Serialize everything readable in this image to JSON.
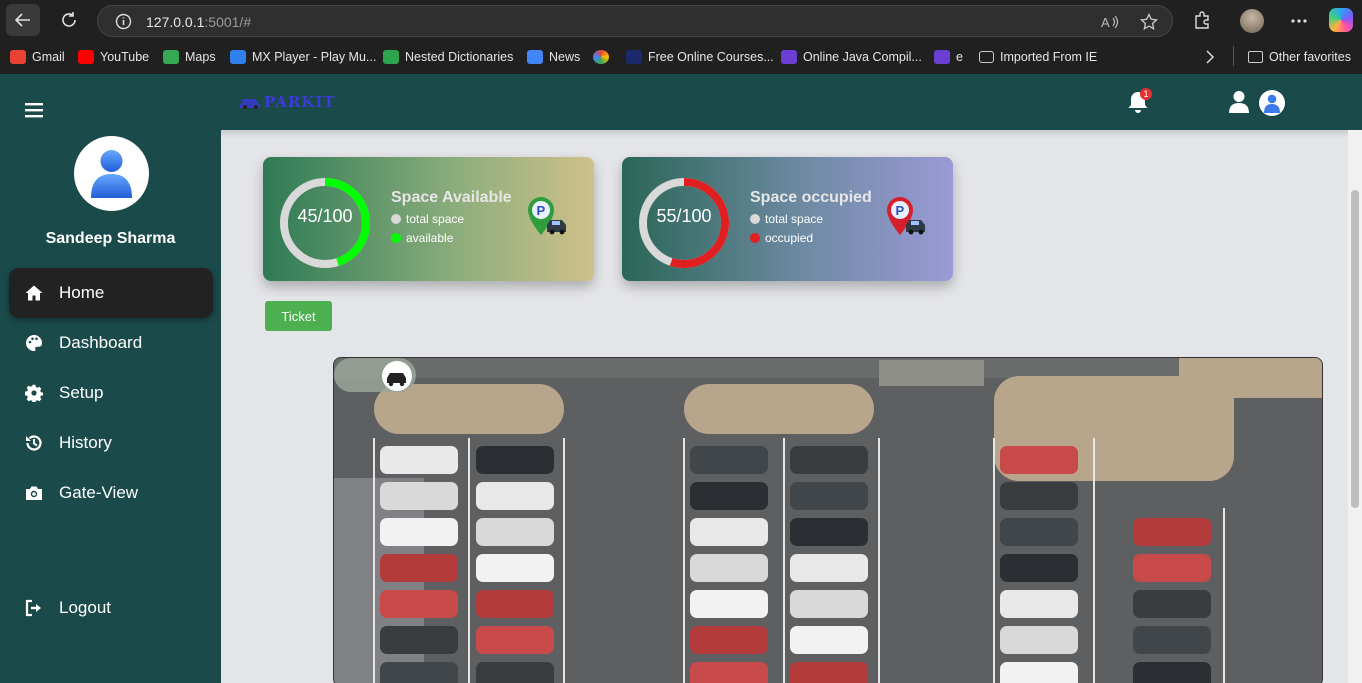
{
  "browser": {
    "url_host": "127.0.0.1",
    "url_rest": ":5001/#",
    "bookmarks": [
      {
        "label": "Gmail",
        "color": "#ea4335"
      },
      {
        "label": "YouTube",
        "color": "#ff0000"
      },
      {
        "label": "Maps",
        "color": "#34a853"
      },
      {
        "label": "MX Player - Play Mu...",
        "color": "#2f80ed"
      },
      {
        "label": "Nested Dictionaries",
        "color": "#2ea44f"
      },
      {
        "label": "News",
        "color": "#4285f4"
      },
      {
        "label": "",
        "color": "#ffffff"
      },
      {
        "label": "Free Online Courses...",
        "color": "#1a2a6c"
      },
      {
        "label": "Online Java Compil...",
        "color": "#6b3fd4"
      },
      {
        "label": "e",
        "color": "#6b3fd4"
      },
      {
        "label": "Imported From IE",
        "color": "#cccccc"
      }
    ],
    "other_favorites": "Other favorites"
  },
  "app": {
    "logo": "PARKIT",
    "notification_count": "1",
    "user_name": "Sandeep Sharma",
    "nav": [
      {
        "label": "Home",
        "icon": "home-icon",
        "active": true
      },
      {
        "label": "Dashboard",
        "icon": "palette-icon"
      },
      {
        "label": "Setup",
        "icon": "gear-icon"
      },
      {
        "label": "History",
        "icon": "history-icon"
      },
      {
        "label": "Gate-View",
        "icon": "camera-icon"
      }
    ],
    "logout": "Logout",
    "cards": {
      "available": {
        "title": "Space Available",
        "value": "45/100",
        "fraction": 0.45,
        "legend_total": "total space",
        "legend_sub": "available",
        "accent": "#00ff00"
      },
      "occupied": {
        "title": "Space occupied",
        "value": "55/100",
        "fraction": 0.55,
        "legend_total": "total space",
        "legend_sub": "occupied",
        "accent": "#e02020"
      }
    },
    "ticket_button": "Ticket"
  }
}
